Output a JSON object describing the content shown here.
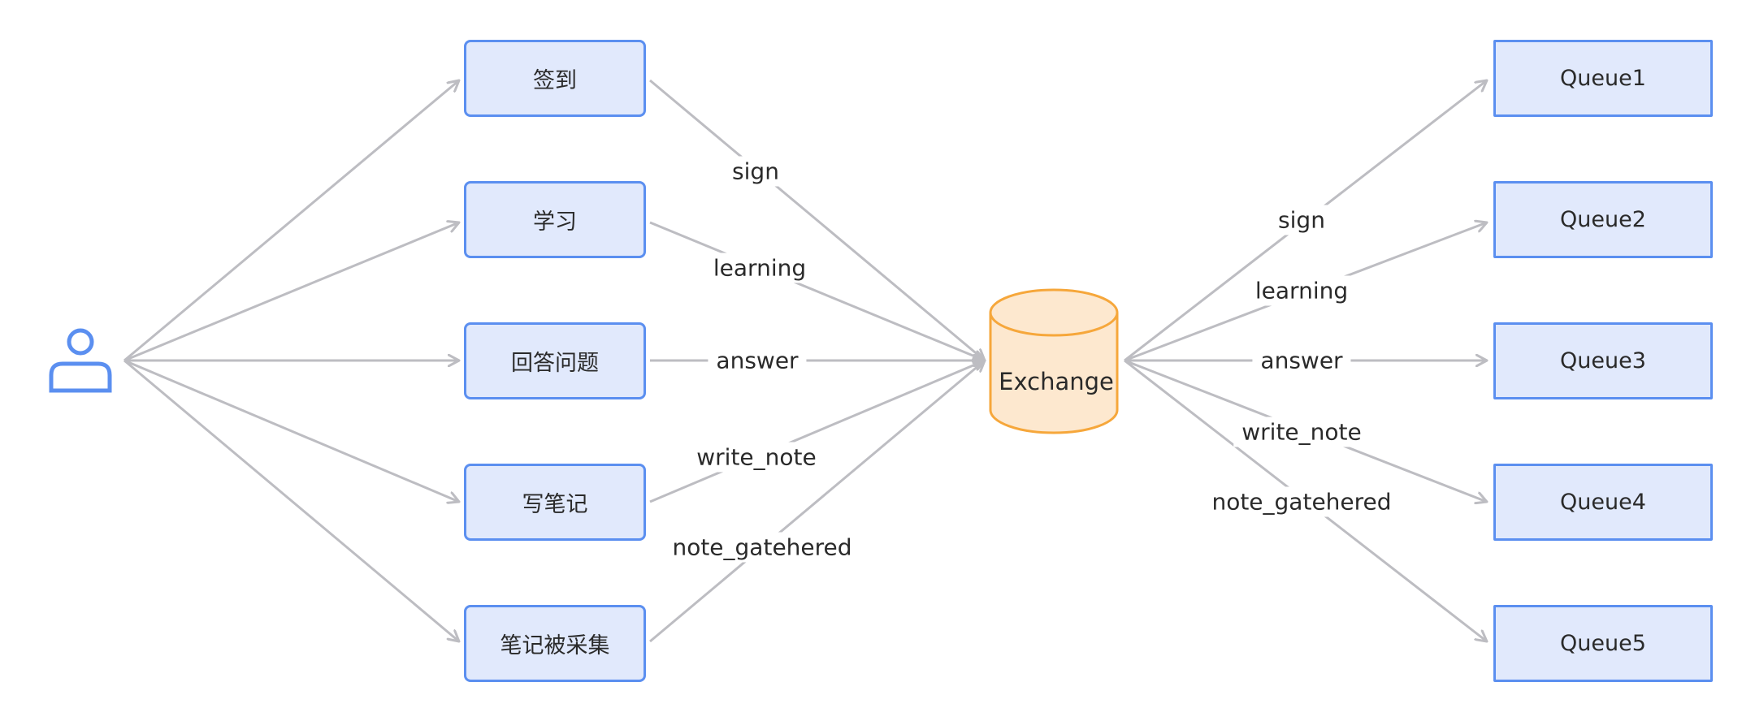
{
  "colors": {
    "node_fill": "#e1e9fc",
    "node_border": "#5b8ff0",
    "edge": "#bdbdc2",
    "exchange_fill": "#fde8cf",
    "exchange_border": "#f6a73b",
    "user_icon": "#5b8ff0"
  },
  "user": {
    "icon": "user-icon"
  },
  "actions": [
    {
      "label": "签到"
    },
    {
      "label": "学习"
    },
    {
      "label": "回答问题"
    },
    {
      "label": "写笔记"
    },
    {
      "label": "笔记被采集"
    }
  ],
  "exchange": {
    "label": "Exchange"
  },
  "queues": [
    {
      "label": "Queue1"
    },
    {
      "label": "Queue2"
    },
    {
      "label": "Queue3"
    },
    {
      "label": "Queue4"
    },
    {
      "label": "Queue5"
    }
  ],
  "publish_routing_keys": [
    "sign",
    "learning",
    "answer",
    "write_note",
    "note_gatehered"
  ],
  "binding_routing_keys": [
    "sign",
    "learning",
    "answer",
    "write_note",
    "note_gatehered"
  ]
}
